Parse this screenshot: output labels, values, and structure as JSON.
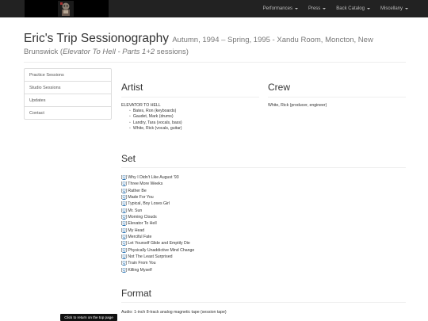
{
  "nav": {
    "logo_name": "site-logo",
    "items": [
      {
        "label": "Performances"
      },
      {
        "label": "Press"
      },
      {
        "label": "Back Catalog"
      },
      {
        "label": "Miscellany"
      }
    ]
  },
  "header": {
    "title": "Eric's Trip Sessionography",
    "subtitle_a": "Autumn, 1994 – Spring, 1995 - Xandu Room, Moncton, New",
    "subtitle_b_pre": "Brunswick (",
    "subtitle_b_em": "Elevator To Hell - Parts 1+2",
    "subtitle_b_post": " sessions)"
  },
  "sidebar": {
    "items": [
      {
        "label": "Practice Sessions"
      },
      {
        "label": "Studio Sessions"
      },
      {
        "label": "Updates"
      },
      {
        "label": "Contact"
      }
    ]
  },
  "artist": {
    "heading": "Artist",
    "band": "ELEVATOR TO HELL",
    "members": [
      "Bates, Ron (keyboards)",
      "Gaudet, Mark (drums)",
      "Landry, Tara (vocals, bass)",
      "White, Rick (vocals, guitar)"
    ]
  },
  "crew": {
    "heading": "Crew",
    "text": "White, Rick (producer, engineer)"
  },
  "set": {
    "heading": "Set",
    "link_label": "Q",
    "songs": [
      "Why I Didn't Like August '93",
      "Three More Weeks",
      "Rather Be",
      "Made For You",
      "Typical, Boy Loses Girl",
      "Mr. Sun",
      "Morning Clouds",
      "Elevator To Hell",
      "My Head",
      "Merciful Fate",
      "Let Yourself Glide and Emptily Die",
      "Physically Unaddictive Mind Change",
      "Not The Least Surprised",
      "Train From You",
      "Killing Myself"
    ]
  },
  "format": {
    "heading": "Format",
    "text": "Audio: 1-inch 8-track analog magnetic tape (session tape)"
  },
  "tooltip": {
    "text": "Click to return on the top page"
  }
}
